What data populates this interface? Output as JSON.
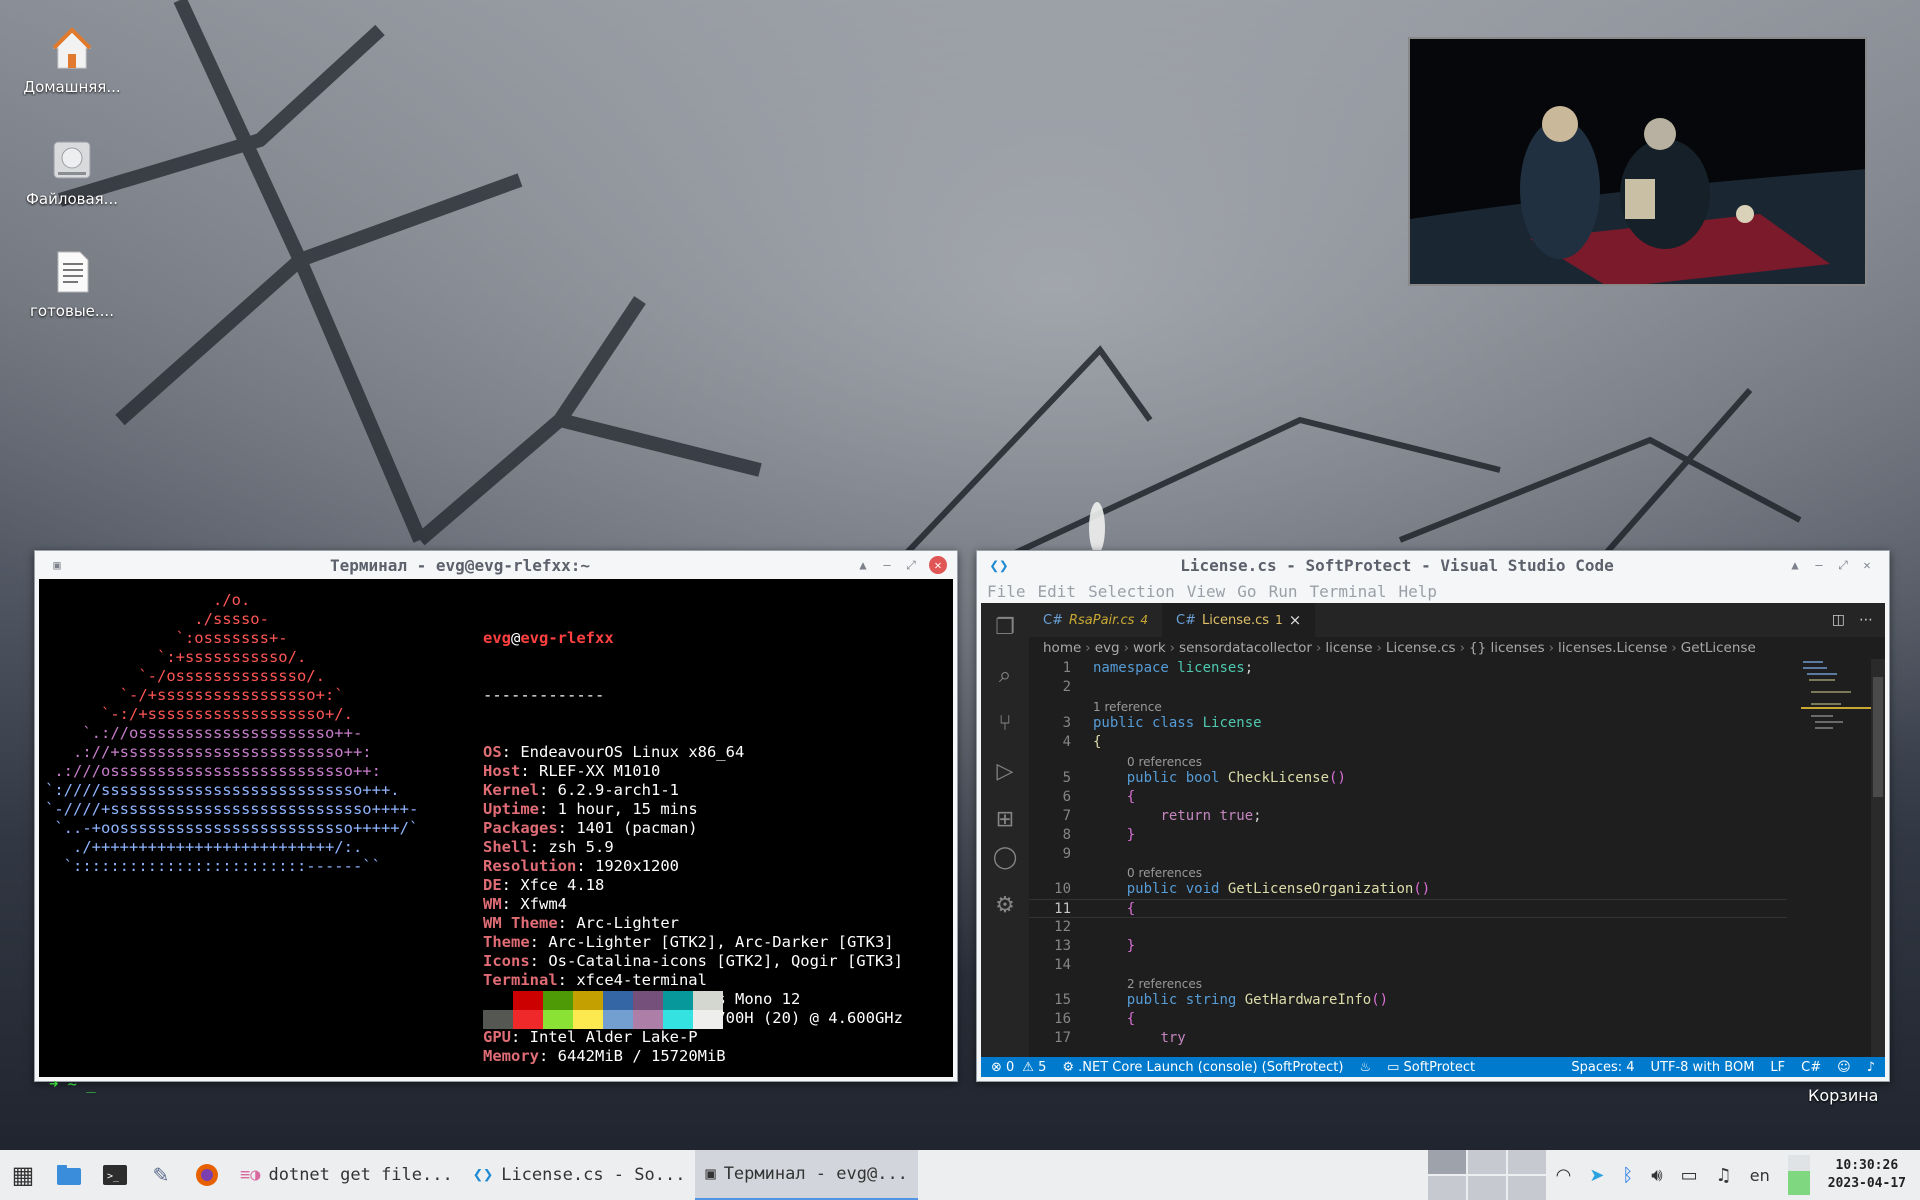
{
  "desktop": {
    "icons": [
      {
        "label": "Домашняя..."
      },
      {
        "label": "Файловая..."
      },
      {
        "label": "готовые...."
      }
    ],
    "trash_label": "Корзина"
  },
  "terminal": {
    "title": "Терминал - evg@evg-rlefxx:~",
    "ascii": [
      "                  ./o.",
      "                ./sssso-",
      "              `:osssssss+-",
      "            `:+sssssssssso/.",
      "          `-/ossssssssssssso/.",
      "        `-/+sssssssssssssssso+:`",
      "      `-:/+sssssssssssssssssso+/.",
      "    `.://osssssssssssssssssssso++-",
      "   .://+ssssssssssssssssssssssso++:",
      " .:///ossssssssssssssssssssssssso++:",
      "`:////ssssssssssssssssssssssssssso+++.",
      "`-////+ssssssssssssssssssssssssssso++++-",
      " `..-+oosssssssssssssssssssssssso+++++/`",
      "   ./++++++++++++++++++++++++++/:.",
      "  `:::::::::::::::::::::::::------``"
    ],
    "user": "evg",
    "at": "@",
    "host": "evg-rlefxx",
    "separator": "-------------",
    "info": [
      {
        "key": "OS",
        "value": "EndeavourOS Linux x86_64"
      },
      {
        "key": "Host",
        "value": "RLEF-XX M1010"
      },
      {
        "key": "Kernel",
        "value": "6.2.9-arch1-1"
      },
      {
        "key": "Uptime",
        "value": "1 hour, 15 mins"
      },
      {
        "key": "Packages",
        "value": "1401 (pacman)"
      },
      {
        "key": "Shell",
        "value": "zsh 5.9"
      },
      {
        "key": "Resolution",
        "value": "1920x1200"
      },
      {
        "key": "DE",
        "value": "Xfce 4.18"
      },
      {
        "key": "WM",
        "value": "Xfwm4"
      },
      {
        "key": "WM Theme",
        "value": "Arc-Lighter"
      },
      {
        "key": "Theme",
        "value": "Arc-Lighter [GTK2], Arc-Darker [GTK3]"
      },
      {
        "key": "Icons",
        "value": "Os-Catalina-icons [GTK2], Qogir [GTK3]"
      },
      {
        "key": "Terminal",
        "value": "xfce4-terminal"
      },
      {
        "key": "Terminal Font",
        "value": "DejaVu Sans Mono 12"
      },
      {
        "key": "CPU",
        "value": "12th Gen Intel i7-12700H (20) @ 4.600GHz"
      },
      {
        "key": "GPU",
        "value": "Intel Alder Lake-P"
      },
      {
        "key": "Memory",
        "value": "6442MiB / 15720MiB"
      }
    ],
    "colors_top": [
      "#000000",
      "#cc0000",
      "#4e9a06",
      "#c4a000",
      "#3465a4",
      "#75507b",
      "#06989a",
      "#d3d7cf"
    ],
    "colors_bottom": [
      "#555753",
      "#ef2929",
      "#8ae234",
      "#fce94f",
      "#729fcf",
      "#ad7fa8",
      "#34e2e2",
      "#eeeeec"
    ],
    "prompt": "➜  ~ _"
  },
  "vscode": {
    "title": "License.cs - SoftProtect - Visual Studio Code",
    "menu": [
      "File",
      "Edit",
      "Selection",
      "View",
      "Go",
      "Run",
      "Terminal",
      "Help"
    ],
    "tabs": [
      {
        "name": "RsaPair.cs",
        "count": "4"
      },
      {
        "name": "License.cs",
        "count": "1",
        "close": "×"
      }
    ],
    "breadcrumbs": [
      "home",
      "evg",
      "work",
      "sensordatacollector",
      "license",
      "License.cs",
      "{} licenses",
      "licenses.License",
      "GetLicense"
    ],
    "lens": {
      "ref1": "1 reference",
      "ref0a": "0 references",
      "ref0b": "0 references",
      "ref2": "2 references"
    },
    "code": {
      "l1_kw": "namespace",
      "l1_name": "licenses",
      "l1_end": ";",
      "l3_kw": "public class",
      "l3_name": "License",
      "l4": "{",
      "l5_kw": "public bool",
      "l5_fn": "CheckLicense",
      "l5_p": "()",
      "l6": "{",
      "l7_kw": "return true",
      "l7_end": ";",
      "l8": "}",
      "l10_kw": "public void",
      "l10_fn": "GetLicenseOrganization",
      "l10_p": "()",
      "l11": "{",
      "l13": "}",
      "l15_kw": "public",
      "l15_tp": "string",
      "l15_fn": "GetHardwareInfo",
      "l15_p": "()",
      "l16": "{",
      "l17": "try",
      "line_numbers": [
        "1",
        "2",
        "3",
        "4",
        "5",
        "6",
        "7",
        "8",
        "9",
        "10",
        "11",
        "12",
        "13",
        "14",
        "15",
        "16",
        "17"
      ]
    },
    "status": {
      "errors": "⊗ 0",
      "warnings": "⚠ 5",
      "launch": ".NET Core Launch (console) (SoftProtect)",
      "project": "SoftProtect",
      "spaces": "Spaces: 4",
      "encoding": "UTF-8 with BOM",
      "eol": "LF",
      "lang": "C#"
    }
  },
  "taskbar": {
    "tasks": [
      {
        "label": "dotnet get file..."
      },
      {
        "label": "License.cs - So..."
      },
      {
        "label": "Терминал - evg@..."
      }
    ],
    "lang": "en",
    "time": "10:30:26",
    "date": "2023-04-17"
  }
}
